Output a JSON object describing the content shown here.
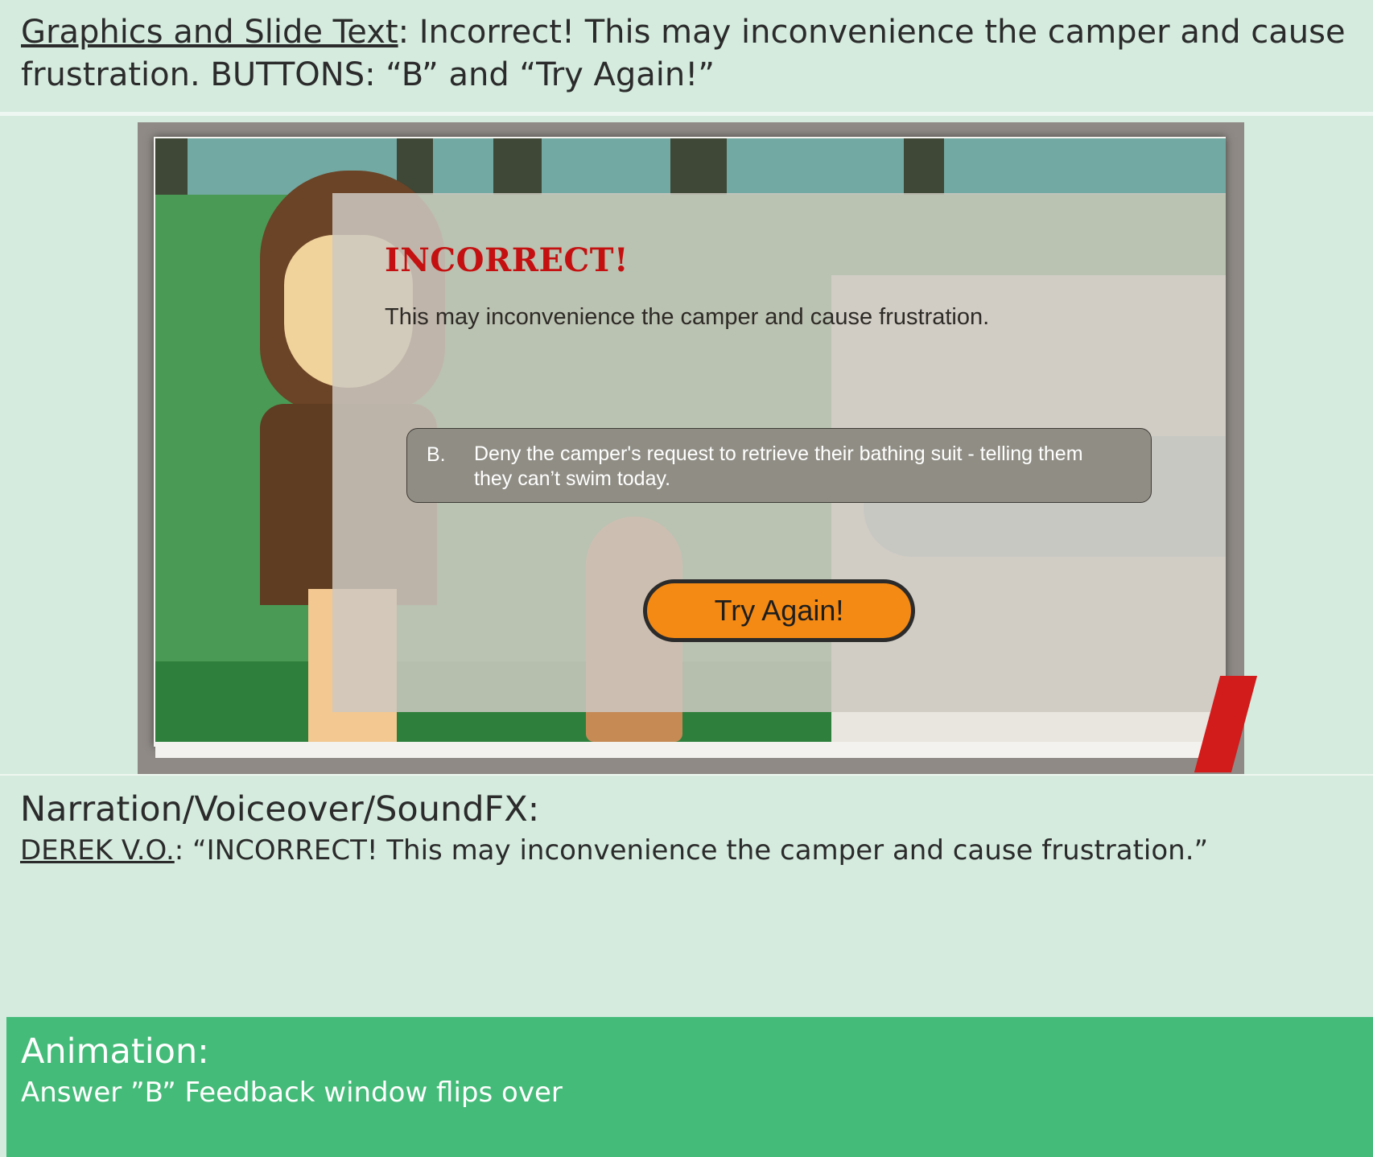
{
  "header": {
    "label": "Graphics and Slide Text",
    "colon": ":",
    "text": " Incorrect! This may inconvenience the camper and cause frustration. BUTTONS: “B” and “Try Again!”"
  },
  "slide": {
    "title": "INCORRECT!",
    "message": "This may inconvenience the camper and cause frustration.",
    "answer_letter": "B.",
    "answer_text": "Deny the camper's request to retrieve their bathing suit - telling them they can’t swim today.",
    "try_again_label": "Try Again!",
    "colors": {
      "title": "#c41010",
      "button": "#f48a14",
      "answer_box": "#8f8d84"
    }
  },
  "narration": {
    "title": "Narration/Voiceover/SoundFX:",
    "speaker": "DEREK V.O.",
    "colon": ":",
    "line": " “INCORRECT! This may inconvenience the camper and cause frustration.”"
  },
  "animation": {
    "title": "Animation:",
    "line": "Answer ”B” Feedback window flips over"
  }
}
